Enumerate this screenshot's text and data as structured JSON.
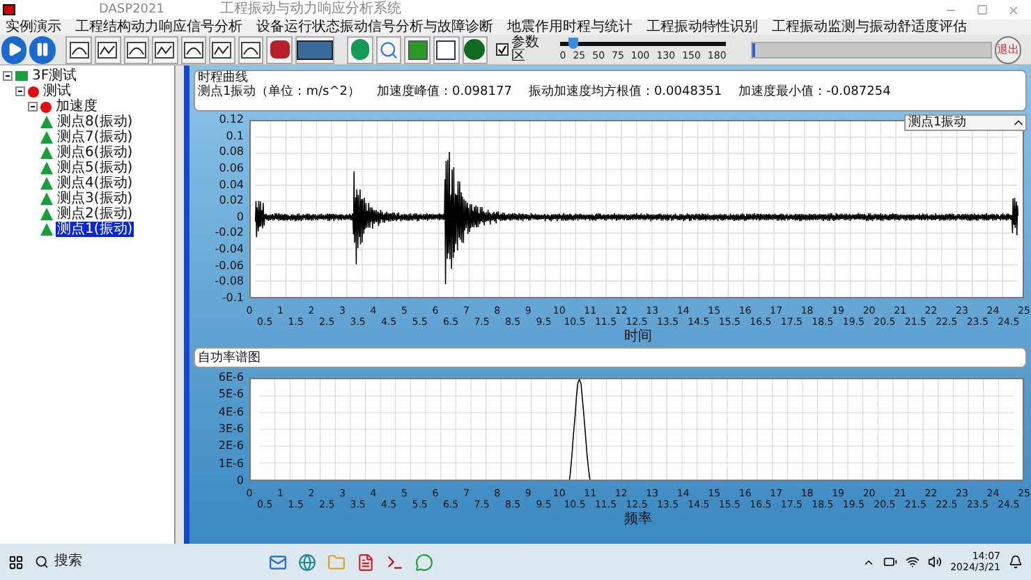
{
  "window": {
    "app": "DASP2021",
    "title": "工程振动与动力响应分析系统"
  },
  "menu": [
    "实例演示",
    "工程结构动力响应信号分析",
    "设备运行状态振动信号分析与故障诊断",
    "地震作用时程与统计",
    "工程振动特性识别",
    "工程振动监测与振动舒适度评估"
  ],
  "toolbar": {
    "checkbox": {
      "label": "参数区",
      "checked": true
    },
    "slider": {
      "level": 0.08,
      "ticks": [
        "0",
        "25",
        "50",
        "75",
        "100",
        "130",
        "150",
        "180"
      ]
    },
    "progress": {
      "level": 0.01
    },
    "exit": "退出"
  },
  "tree": {
    "label": "3F测试",
    "expanded": true,
    "children": [
      {
        "label": "测试",
        "expanded": true,
        "children": [
          {
            "label": "加速度",
            "expanded": true,
            "children": [
              {
                "label": "测点8(振动)",
                "selected": false
              },
              {
                "label": "测点7(振动)",
                "selected": false
              },
              {
                "label": "测点6(振动)",
                "selected": false
              },
              {
                "label": "测点5(振动)",
                "selected": false
              },
              {
                "label": "测点4(振动)",
                "selected": false
              },
              {
                "label": "测点3(振动)",
                "selected": false
              },
              {
                "label": "测点2(振动)",
                "selected": false
              },
              {
                "label": "测点1(振动)",
                "selected": true
              }
            ]
          }
        ]
      }
    ]
  },
  "info": {
    "title": "时程曲线",
    "fields": [
      "测点1振动（单位：m/s^2）",
      "加速度峰值：0.098177",
      "振动加速度均方根值：0.0048351",
      "加速度最小值：-0.087254"
    ]
  },
  "channel_select": "测点1振动",
  "waveform": {
    "yticks": [
      "0.12",
      "0.1",
      "0.08",
      "0.06",
      "0.04",
      "0.02",
      "0",
      "-0.02",
      "-0.04",
      "-0.06",
      "-0.08",
      "-0.1"
    ],
    "xticks": [
      "0",
      "0.5",
      "1",
      "1.5",
      "2",
      "2.5",
      "3",
      "3.5",
      "4",
      "4.5",
      "5",
      "5.5",
      "6",
      "6.5",
      "7",
      "7.5",
      "8",
      "8.5",
      "9",
      "9.5",
      "10",
      "10.5",
      "11",
      "11.5",
      "12",
      "12.5",
      "13",
      "13.5",
      "14",
      "14.5",
      "15",
      "15.5",
      "16",
      "16.5",
      "17",
      "17.5",
      "18",
      "18.5",
      "19",
      "19.5",
      "20",
      "20.5",
      "21",
      "21.5",
      "22",
      "22.5",
      "23",
      "23.5",
      "24",
      "24.5",
      "25"
    ],
    "xlabel": "时间"
  },
  "spectrum": {
    "title": "自功率谱图",
    "yticks": [
      "6E-6",
      "5E-6",
      "4E-6",
      "3E-6",
      "2E-6",
      "1E-6",
      "0"
    ],
    "xticks": [
      "0",
      "0.5",
      "1",
      "1.5",
      "2",
      "2.5",
      "3",
      "3.5",
      "4",
      "4.5",
      "5",
      "5.5",
      "6",
      "6.5",
      "7",
      "7.5",
      "8",
      "8.5",
      "9",
      "9.5",
      "10",
      "10.5",
      "11",
      "11.5",
      "12",
      "12.5",
      "13",
      "13.5",
      "14",
      "14.5",
      "15",
      "15.5",
      "16",
      "16.5",
      "17",
      "17.5",
      "18",
      "18.5",
      "19",
      "19.5",
      "20",
      "20.5",
      "21",
      "21.5",
      "22",
      "22.5",
      "23",
      "23.5",
      "24",
      "24.5",
      "25"
    ],
    "xlabel": "频率"
  },
  "taskbar": {
    "search": "搜索",
    "time": "14:07",
    "date": "2024/3/21"
  }
}
